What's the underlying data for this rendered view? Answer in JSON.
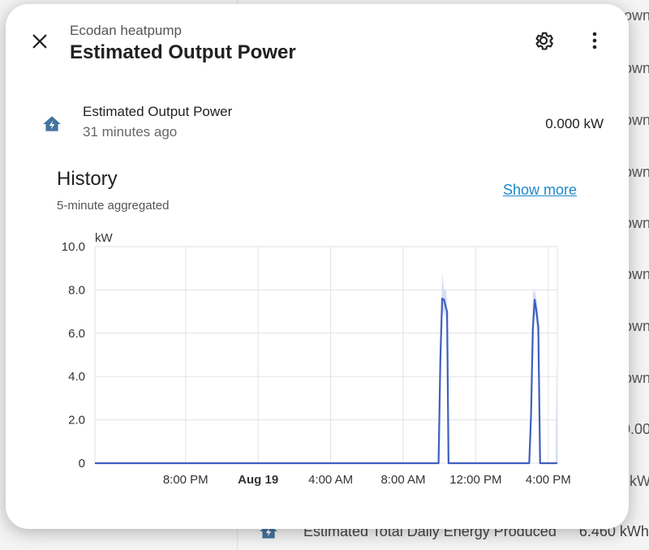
{
  "background": {
    "fragments": [
      "own",
      "own",
      "own",
      "own",
      "own",
      "own",
      "own",
      "own",
      "0.00",
      "kW"
    ],
    "row": {
      "label": "Estimated Total Daily Energy Produced",
      "value": "6.460 kWh"
    }
  },
  "dialog": {
    "subtitle": "Ecodan heatpump",
    "title": "Estimated Output Power",
    "icons": {
      "close": "close-icon",
      "settings": "gear-icon",
      "more": "more-vertical-icon"
    }
  },
  "entity": {
    "icon": "home-lightning-icon",
    "name": "Estimated Output Power",
    "last_changed": "31 minutes ago",
    "state": "0.000 kW"
  },
  "history": {
    "title": "History",
    "subtitle": "5-minute aggregated",
    "show_more": "Show more"
  },
  "colors": {
    "line": "#3f5fbf",
    "band": "#c8d4f3",
    "accent": "#1e88c9",
    "icon": "#44739e"
  },
  "chart_data": {
    "type": "line",
    "ylabel": "kW",
    "ylim": [
      0,
      10
    ],
    "yticks": [
      "0",
      "2.0",
      "4.0",
      "6.0",
      "8.0",
      "10.0"
    ],
    "xlim_hours": [
      15.0,
      40.5
    ],
    "xticks": [
      {
        "hour": 20,
        "label": "8:00 PM",
        "bold": false
      },
      {
        "hour": 24,
        "label": "Aug 19",
        "bold": true
      },
      {
        "hour": 28,
        "label": "4:00 AM",
        "bold": false
      },
      {
        "hour": 32,
        "label": "8:00 AM",
        "bold": false
      },
      {
        "hour": 36,
        "label": "12:00 PM",
        "bold": false
      },
      {
        "hour": 40,
        "label": "4:00 PM",
        "bold": false
      }
    ],
    "series": [
      {
        "mean": [
          [
            15.0,
            0
          ],
          [
            33.95,
            0
          ],
          [
            34.05,
            4.8
          ],
          [
            34.15,
            7.6
          ],
          [
            34.25,
            7.55
          ],
          [
            34.35,
            7.2
          ],
          [
            34.42,
            7.0
          ],
          [
            34.5,
            0
          ],
          [
            38.95,
            0
          ],
          [
            39.05,
            2.2
          ],
          [
            39.15,
            6.2
          ],
          [
            39.25,
            7.55
          ],
          [
            39.35,
            7.0
          ],
          [
            39.45,
            6.3
          ],
          [
            39.55,
            0
          ],
          [
            40.5,
            0
          ]
        ],
        "max": [
          [
            15.0,
            0
          ],
          [
            33.95,
            0
          ],
          [
            34.05,
            5.5
          ],
          [
            34.15,
            8.8
          ],
          [
            34.25,
            8.0
          ],
          [
            34.35,
            8.0
          ],
          [
            34.42,
            7.5
          ],
          [
            34.5,
            0
          ],
          [
            38.95,
            0
          ],
          [
            39.05,
            3.0
          ],
          [
            39.15,
            7.9
          ],
          [
            39.25,
            8.0
          ],
          [
            39.35,
            7.6
          ],
          [
            39.45,
            7.0
          ],
          [
            39.55,
            0
          ],
          [
            40.4,
            0
          ],
          [
            40.45,
            4.5
          ],
          [
            40.5,
            0
          ]
        ],
        "min": [
          [
            15.0,
            0
          ],
          [
            33.95,
            0
          ],
          [
            34.05,
            3.8
          ],
          [
            34.15,
            6.8
          ],
          [
            34.25,
            7.0
          ],
          [
            34.35,
            6.6
          ],
          [
            34.42,
            6.2
          ],
          [
            34.5,
            0
          ],
          [
            38.95,
            0
          ],
          [
            39.05,
            1.0
          ],
          [
            39.15,
            5.0
          ],
          [
            39.25,
            7.0
          ],
          [
            39.35,
            6.3
          ],
          [
            39.45,
            5.5
          ],
          [
            39.55,
            0
          ],
          [
            40.5,
            0
          ]
        ]
      }
    ],
    "grid": true
  }
}
